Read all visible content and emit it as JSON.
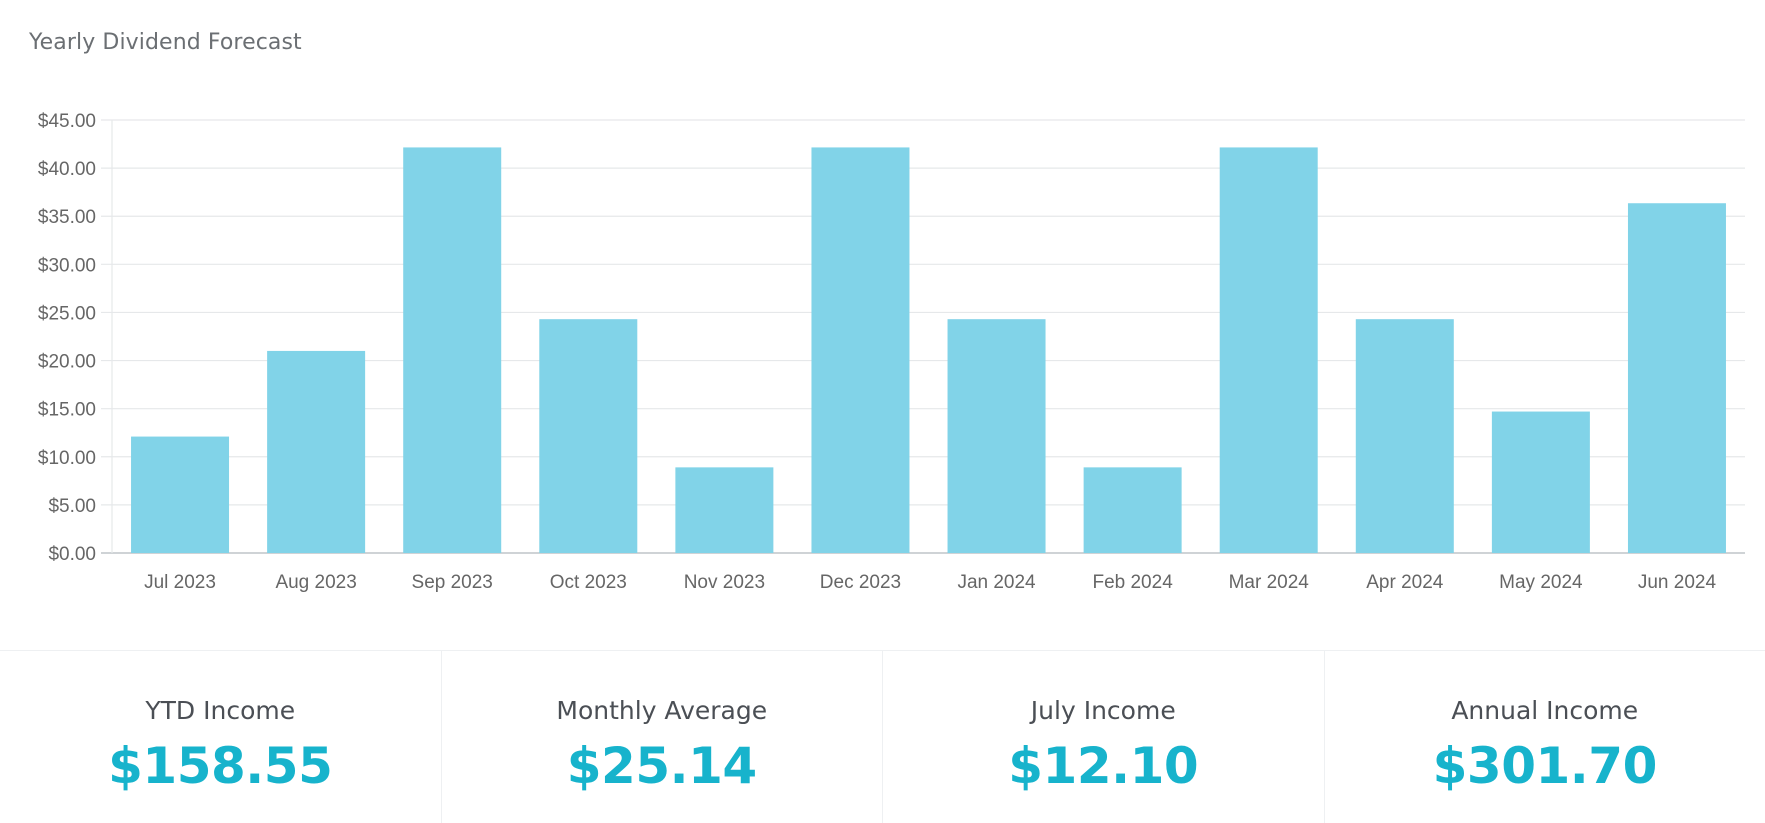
{
  "card": {
    "title": "Yearly Dividend Forecast"
  },
  "chart_data": {
    "type": "bar",
    "categories": [
      "Jul 2023",
      "Aug 2023",
      "Sep 2023",
      "Oct 2023",
      "Nov 2023",
      "Dec 2023",
      "Jan 2024",
      "Feb 2024",
      "Mar 2024",
      "Apr 2024",
      "May 2024",
      "Jun 2024"
    ],
    "values": [
      12.1,
      21.0,
      42.15,
      24.3,
      8.9,
      42.15,
      24.3,
      8.9,
      42.15,
      24.3,
      14.7,
      36.35
    ],
    "title": "",
    "xlabel": "",
    "ylabel": "",
    "ylim": [
      0,
      45
    ],
    "yticks": [
      "$0.00",
      "$5.00",
      "$10.00",
      "$15.00",
      "$20.00",
      "$25.00",
      "$30.00",
      "$35.00",
      "$40.00",
      "$45.00"
    ],
    "ytick_values": [
      0,
      5,
      10,
      15,
      20,
      25,
      30,
      35,
      40,
      45
    ],
    "bar_color": "#81d3e8",
    "grid": true,
    "legend": false
  },
  "stats": [
    {
      "label": "YTD Income",
      "value": "$158.55"
    },
    {
      "label": "Monthly Average",
      "value": "$25.14"
    },
    {
      "label": "July Income",
      "value": "$12.10"
    },
    {
      "label": "Annual Income",
      "value": "$301.70"
    }
  ],
  "colors": {
    "accent": "#17b3cc",
    "bar": "#81d3e8",
    "grid": "#e6e8ea",
    "axis_text": "#666666"
  }
}
